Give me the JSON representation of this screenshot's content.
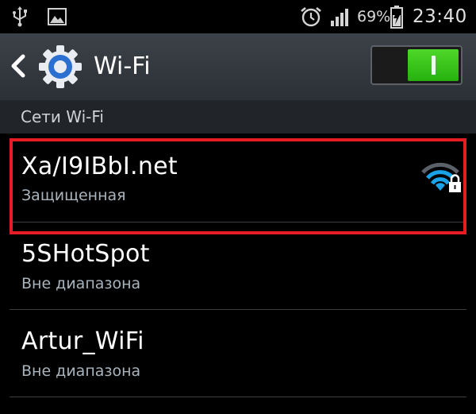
{
  "status_bar": {
    "usb_icon": "usb-icon",
    "gallery_icon": "image-icon",
    "alarm_icon": "alarm-clock-icon",
    "signal_icon": "cell-signal-icon",
    "battery_percent": "69%",
    "battery_icon": "battery-charging-icon",
    "time": "23:40"
  },
  "action_bar": {
    "back_icon": "chevron-left-icon",
    "app_icon": "settings-gear-icon",
    "title": "Wi-Fi",
    "switch_state": "on",
    "switch_color": "#31c41a"
  },
  "section": {
    "title": "Сети Wi-Fi"
  },
  "networks": [
    {
      "name": "Xa/I9IBbI.net",
      "status": "Защищенная",
      "secured": true,
      "signal_icon": "wifi-locked-icon",
      "highlighted": true
    },
    {
      "name": "5SHotSpot",
      "status": "Вне диапазона",
      "secured": false
    },
    {
      "name": "Artur_WiFi",
      "status": "Вне диапазона",
      "secured": false
    }
  ],
  "colors": {
    "background": "#000000",
    "action_bar": "#353a40",
    "section_header": "#212428",
    "secondary_text": "#a9b4bd",
    "wifi_signal": "#1aa3e8",
    "highlight": "#e51c23"
  }
}
